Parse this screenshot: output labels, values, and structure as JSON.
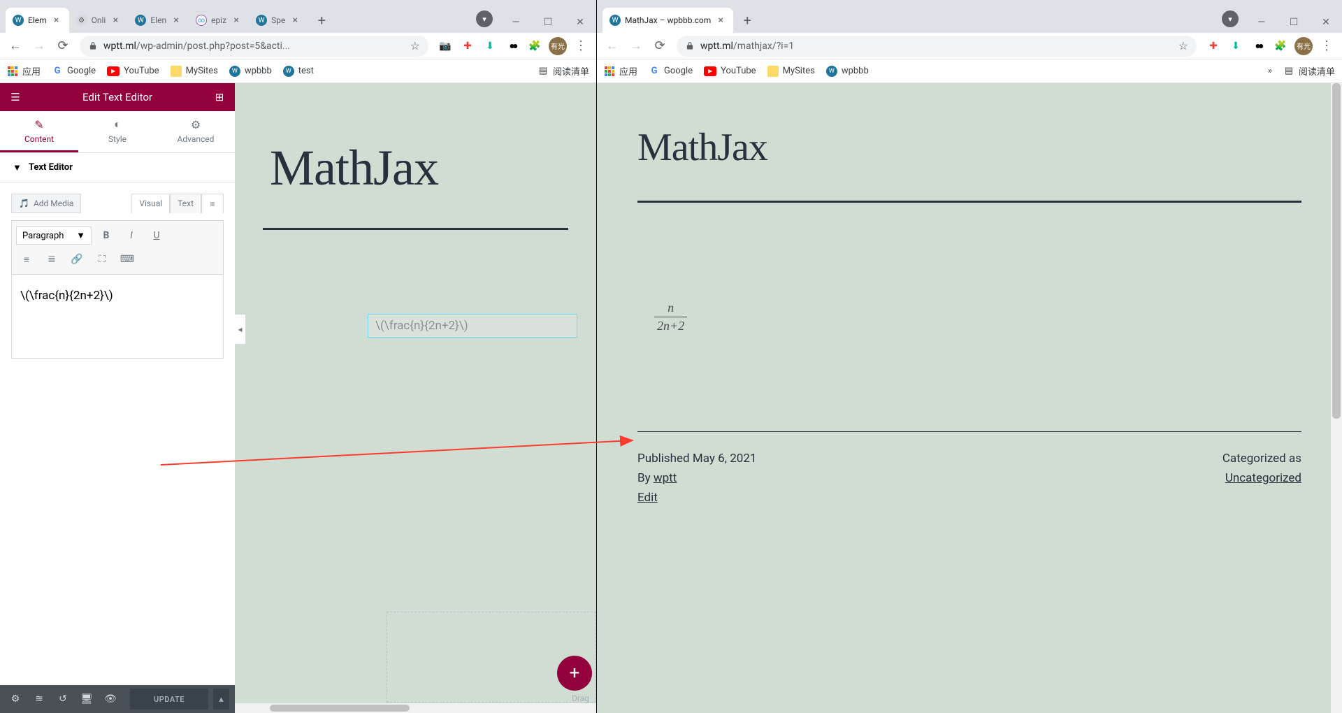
{
  "left": {
    "tabs": [
      {
        "title": "Elem",
        "active": true,
        "favicon": "wp"
      },
      {
        "title": "Onli",
        "active": false,
        "favicon": "gear"
      },
      {
        "title": "Elen",
        "active": false,
        "favicon": "wp"
      },
      {
        "title": "epiz",
        "active": false,
        "favicon": "inf"
      },
      {
        "title": "Spe",
        "active": false,
        "favicon": "wp"
      }
    ],
    "url_host": "wptt.ml",
    "url_path": "/wp-admin/post.php?post=5&acti...",
    "bookmarks": {
      "apps": "应用",
      "google": "Google",
      "youtube": "YouTube",
      "mysites": "MySites",
      "wpbbb": "wpbbb",
      "test": "test",
      "reading": "阅读清单"
    },
    "panel": {
      "header": "Edit Text Editor",
      "tabs": {
        "content": "Content",
        "style": "Style",
        "advanced": "Advanced"
      },
      "section": "Text Editor",
      "add_media": "Add Media",
      "editor_tabs": {
        "visual": "Visual",
        "text": "Text"
      },
      "paragraph": "Paragraph",
      "content": "\\(\\frac{n}{2n+2}\\)",
      "update": "UPDATE"
    },
    "canvas": {
      "title": "MathJax",
      "textbox": "\\(\\frac{n}{2n+2}\\)",
      "drag": "Drag"
    }
  },
  "right": {
    "tab": {
      "title": "MathJax – wpbbb.com",
      "favicon": "wp"
    },
    "url_host": "wptt.ml",
    "url_path": "/mathjax/?i=1",
    "bookmarks": {
      "apps": "应用",
      "google": "Google",
      "youtube": "YouTube",
      "mysites": "MySites",
      "wpbbb": "wpbbb",
      "reading": "阅读清单"
    },
    "page": {
      "title": "MathJax",
      "formula": {
        "numerator": "n",
        "denominator": "2n+2"
      },
      "published_label": "Published",
      "published_date": "May 6, 2021",
      "by_label": "By",
      "author": "wptt",
      "edit": "Edit",
      "cat_label": "Categorized as",
      "category": "Uncategorized"
    }
  },
  "avatar": "有光"
}
